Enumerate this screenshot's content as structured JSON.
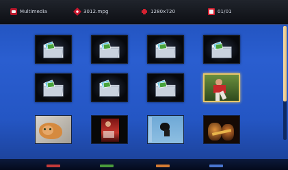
{
  "topbar": {
    "app_label": "Multimedia",
    "app_icon": "multimedia-icon",
    "file_label": "3012.mpg",
    "file_icon": "file-icon",
    "resolution_label": "1280x720",
    "resolution_icon": "resolution-icon",
    "page_label": "01/01",
    "page_icon": "page-icon"
  },
  "grid": {
    "items": [
      {
        "type": "folder"
      },
      {
        "type": "folder"
      },
      {
        "type": "folder"
      },
      {
        "type": "folder"
      },
      {
        "type": "folder"
      },
      {
        "type": "folder"
      },
      {
        "type": "folder"
      },
      {
        "type": "photo",
        "selected": true,
        "subject": "person-red-shirt"
      },
      {
        "type": "photo",
        "subject": "cat"
      },
      {
        "type": "photo",
        "subject": "red-people"
      },
      {
        "type": "photo",
        "subject": "light-blue-figure"
      },
      {
        "type": "photo",
        "subject": "band"
      }
    ]
  },
  "scroll": {
    "position": 0,
    "visible_fraction": 0.66
  },
  "colors": {
    "background": "#2456c4",
    "topbar": "#14171d",
    "selection": "#e8c76a",
    "scroll_thumb": "#eccb85"
  },
  "bottom_buttons": [
    {
      "color": "#c43a3a",
      "name": "red"
    },
    {
      "color": "#4a9b3c",
      "name": "green"
    },
    {
      "color": "#d47b33",
      "name": "orange"
    },
    {
      "color": "#4a76d0",
      "name": "blue"
    }
  ]
}
